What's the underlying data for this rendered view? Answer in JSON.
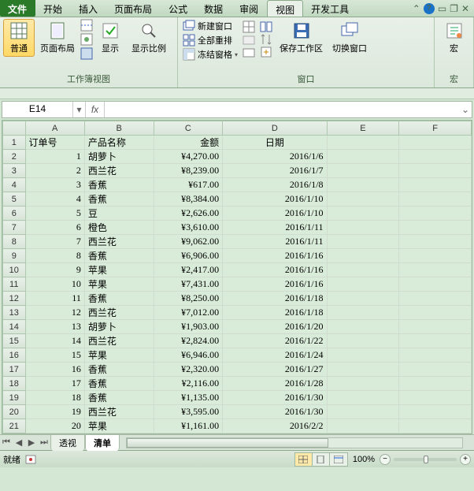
{
  "tabs": {
    "file": "文件",
    "items": [
      "开始",
      "插入",
      "页面布局",
      "公式",
      "数据",
      "审阅",
      "视图",
      "开发工具"
    ],
    "active": "视图"
  },
  "ribbon": {
    "group_views": {
      "label": "工作簿视图",
      "normal": "普通",
      "page_layout": "页面布局",
      "show": "显示",
      "zoom": "显示比例"
    },
    "group_window": {
      "label": "窗口",
      "new_window": "新建窗口",
      "arrange_all": "全部重排",
      "freeze": "冻结窗格",
      "save_ws": "保存工作区",
      "switch": "切换窗口"
    },
    "group_macro": {
      "label": "宏",
      "macro": "宏"
    }
  },
  "namebox": "E14",
  "fx": "fx",
  "columns": [
    "A",
    "B",
    "C",
    "D",
    "E",
    "F"
  ],
  "headers": {
    "order": "订单号",
    "product": "产品名称",
    "amount": "金额",
    "date": "日期"
  },
  "chart_data": {
    "type": "table",
    "columns": [
      "订单号",
      "产品名称",
      "金额",
      "日期"
    ],
    "rows": [
      [
        1,
        "胡萝卜",
        "¥4,270.00",
        "2016/1/6"
      ],
      [
        2,
        "西兰花",
        "¥8,239.00",
        "2016/1/7"
      ],
      [
        3,
        "香蕉",
        "¥617.00",
        "2016/1/8"
      ],
      [
        4,
        "香蕉",
        "¥8,384.00",
        "2016/1/10"
      ],
      [
        5,
        "豆",
        "¥2,626.00",
        "2016/1/10"
      ],
      [
        6,
        "橙色",
        "¥3,610.00",
        "2016/1/11"
      ],
      [
        7,
        "西兰花",
        "¥9,062.00",
        "2016/1/11"
      ],
      [
        8,
        "香蕉",
        "¥6,906.00",
        "2016/1/16"
      ],
      [
        9,
        "苹果",
        "¥2,417.00",
        "2016/1/16"
      ],
      [
        10,
        "苹果",
        "¥7,431.00",
        "2016/1/16"
      ],
      [
        11,
        "香蕉",
        "¥8,250.00",
        "2016/1/18"
      ],
      [
        12,
        "西兰花",
        "¥7,012.00",
        "2016/1/18"
      ],
      [
        13,
        "胡萝卜",
        "¥1,903.00",
        "2016/1/20"
      ],
      [
        14,
        "西兰花",
        "¥2,824.00",
        "2016/1/22"
      ],
      [
        15,
        "苹果",
        "¥6,946.00",
        "2016/1/24"
      ],
      [
        16,
        "香蕉",
        "¥2,320.00",
        "2016/1/27"
      ],
      [
        17,
        "香蕉",
        "¥2,116.00",
        "2016/1/28"
      ],
      [
        18,
        "香蕉",
        "¥1,135.00",
        "2016/1/30"
      ],
      [
        19,
        "西兰花",
        "¥3,595.00",
        "2016/1/30"
      ],
      [
        20,
        "苹果",
        "¥1,161.00",
        "2016/2/2"
      ]
    ]
  },
  "sheets": {
    "items": [
      "透视",
      "清单"
    ],
    "active": "清单"
  },
  "status": {
    "ready": "就绪",
    "rec": "",
    "zoom": "100%"
  }
}
